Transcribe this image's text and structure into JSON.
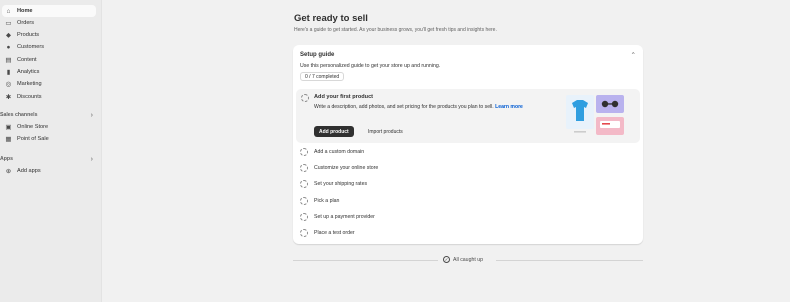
{
  "sidebar": {
    "items": [
      {
        "label": "Home",
        "icon": "home-icon",
        "glyph": "⌂"
      },
      {
        "label": "Orders",
        "icon": "inbox-icon",
        "glyph": "▭"
      },
      {
        "label": "Products",
        "icon": "tag-icon",
        "glyph": "◆"
      },
      {
        "label": "Customers",
        "icon": "person-icon",
        "glyph": "●"
      },
      {
        "label": "Content",
        "icon": "content-icon",
        "glyph": "▤"
      },
      {
        "label": "Analytics",
        "icon": "bar-chart-icon",
        "glyph": "▮"
      },
      {
        "label": "Marketing",
        "icon": "target-icon",
        "glyph": "◎"
      },
      {
        "label": "Discounts",
        "icon": "discount-icon",
        "glyph": "✱"
      }
    ],
    "sales_channels_label": "Sales channels",
    "sales_channels": [
      {
        "label": "Online Store",
        "icon": "store-icon",
        "glyph": "▣"
      },
      {
        "label": "Point of Sale",
        "icon": "pos-icon",
        "glyph": "▦"
      }
    ],
    "apps_label": "Apps",
    "apps": [
      {
        "label": "Add apps",
        "icon": "plus-circle-icon",
        "glyph": "⊕"
      }
    ]
  },
  "main": {
    "title": "Get ready to sell",
    "subtitle": "Here's a guide to get started. As your business grows, you'll get fresh tips and insights here."
  },
  "setup_guide": {
    "title": "Setup guide",
    "description": "Use this personalized guide to get your store up and running.",
    "progress": "0 / 7 completed",
    "expanded_task": {
      "title": "Add your first product",
      "body": "Write a description, add photos, and set pricing for the products you plan to sell.",
      "link": "Learn more",
      "primary_button": "Add product",
      "secondary_button": "Import products"
    },
    "tasks": [
      "Add a custom domain",
      "Customize your online store",
      "Set your shipping rates",
      "Pick a plan",
      "Set up a payment provider",
      "Place a test order"
    ]
  },
  "footer": {
    "caught_up": "All caught up"
  },
  "colors": {
    "accent_link": "#005bd3",
    "primary_button": "#303030",
    "illustration_blue": "#2f9ee0",
    "illustration_purple": "#b9b2ee",
    "illustration_pink": "#f3b9c7"
  }
}
